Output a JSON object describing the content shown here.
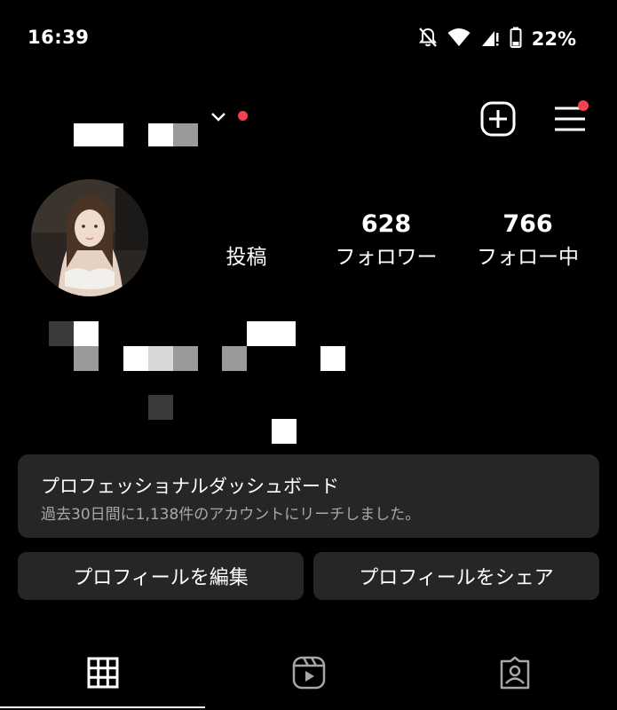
{
  "status_bar": {
    "time": "16:39",
    "battery_percent": "22%",
    "icons": [
      "bell-off-icon",
      "wifi-icon",
      "signal-icon",
      "battery-icon"
    ]
  },
  "header": {
    "username": "",
    "has_account_switcher": true,
    "notification_dot_color": "#f0434f",
    "actions": [
      "create-post-icon",
      "menu-icon"
    ]
  },
  "profile": {
    "stats": [
      {
        "value": "",
        "label": "投稿"
      },
      {
        "value": "628",
        "label": "フォロワー"
      },
      {
        "value": "766",
        "label": "フォロー中"
      }
    ]
  },
  "dashboard": {
    "title": "プロフェッショナルダッシュボード",
    "subtitle": "過去30日間に1,138件のアカウントにリーチしました。"
  },
  "buttons": {
    "edit_profile": "プロフィールを編集",
    "share_profile": "プロフィールをシェア"
  },
  "tabs": [
    {
      "icon": "grid-icon",
      "active": true
    },
    {
      "icon": "reels-icon",
      "active": false
    },
    {
      "icon": "tagged-icon",
      "active": false
    }
  ]
}
